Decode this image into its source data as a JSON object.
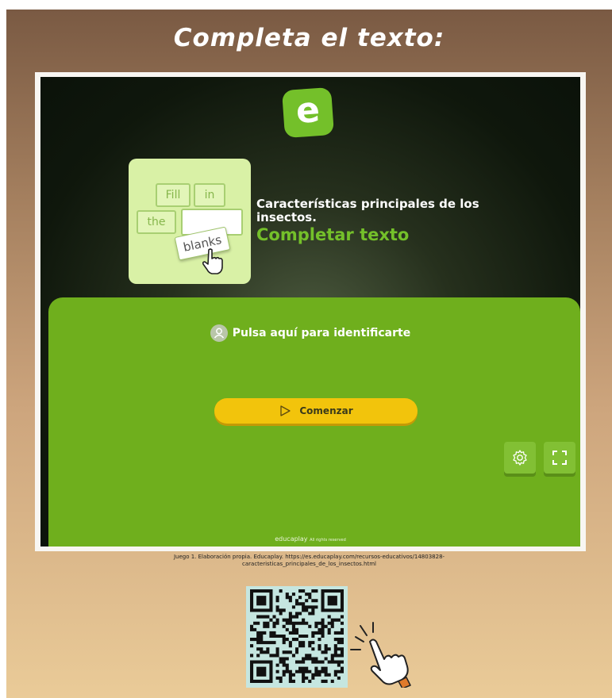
{
  "page": {
    "title": "Completa el texto:"
  },
  "game": {
    "logo_letter": "e",
    "thumbnail_words": [
      "Fill",
      "in",
      "the",
      "blanks"
    ],
    "heading": "Características principales de los insectos.",
    "activity_type": "Completar texto",
    "login_label": "Pulsa aquí para identificarte",
    "start_label": "Comenzar",
    "footer_brand": "educaplay",
    "footer_rights": "All rights reserved",
    "colors": {
      "accent_green": "#6faf1d",
      "start_button": "#f2c40c"
    },
    "icons": [
      "user-icon",
      "play-icon",
      "gear-icon",
      "fullscreen-icon"
    ]
  },
  "caption": {
    "line1": "Juego 1. Elaboración propia. Educaplay. https://es.educaplay.com/recursos-educativos/14803828-",
    "line2": "caracteristicas_principales_de_los_insectos.html"
  }
}
